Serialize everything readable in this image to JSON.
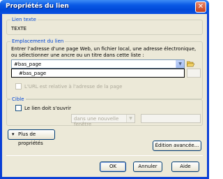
{
  "window": {
    "title": "Propriétés du lien",
    "close_glyph": "✕"
  },
  "link_text": {
    "legend": "Lien texte",
    "value": "TEXTE"
  },
  "location": {
    "legend": "Emplacement du lien",
    "instructions": "Entrer l'adresse d'une page Web, un fichier local, une adresse électronique, ou sélectionner une ancre ou un titre dans cette liste :",
    "url_value": "#bas_page",
    "dropdown_items": [
      "#bas_page"
    ],
    "relative_label": "L'URL est relative à l'adresse de la page"
  },
  "target": {
    "legend": "Cible",
    "open_label": "Le lien doit s'ouvrir",
    "window_select": "dans une nouvelle fenêtre"
  },
  "buttons": {
    "more": "Plus de propriétés",
    "advanced": "Édition avancée...",
    "ok": "OK",
    "cancel": "Annuler",
    "help": "Aide"
  }
}
